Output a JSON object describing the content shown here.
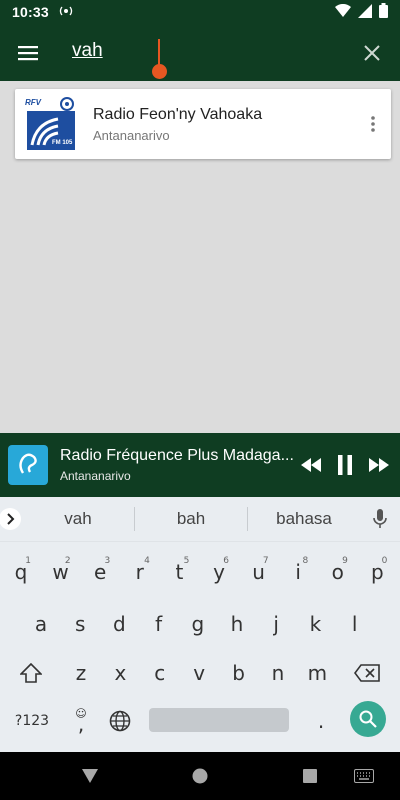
{
  "status_bar": {
    "time": "10:33"
  },
  "search": {
    "value": "vah"
  },
  "results": [
    {
      "title": "Radio Feon'ny Vahoaka",
      "subtitle": "Antananarivo",
      "logo_text_top": "RFV",
      "logo_text_bottom": "FM 105"
    }
  ],
  "player": {
    "title": "Radio Fréquence Plus Madaga...",
    "subtitle": "Antananarivo"
  },
  "keyboard": {
    "suggestions": [
      "vah",
      "bah",
      "bahasa"
    ],
    "row1": [
      {
        "k": "q",
        "n": "1"
      },
      {
        "k": "w",
        "n": "2"
      },
      {
        "k": "e",
        "n": "3"
      },
      {
        "k": "r",
        "n": "4"
      },
      {
        "k": "t",
        "n": "5"
      },
      {
        "k": "y",
        "n": "6"
      },
      {
        "k": "u",
        "n": "7"
      },
      {
        "k": "i",
        "n": "8"
      },
      {
        "k": "o",
        "n": "9"
      },
      {
        "k": "p",
        "n": "0"
      }
    ],
    "row2": [
      "a",
      "s",
      "d",
      "f",
      "g",
      "h",
      "j",
      "k",
      "l"
    ],
    "row3": [
      "z",
      "x",
      "c",
      "v",
      "b",
      "n",
      "m"
    ],
    "symbols_label": "?123",
    "comma": ",",
    "period": "."
  },
  "colors": {
    "app_bar": "#0f3d22",
    "accent": "#e65722",
    "search_key": "#37a993"
  }
}
